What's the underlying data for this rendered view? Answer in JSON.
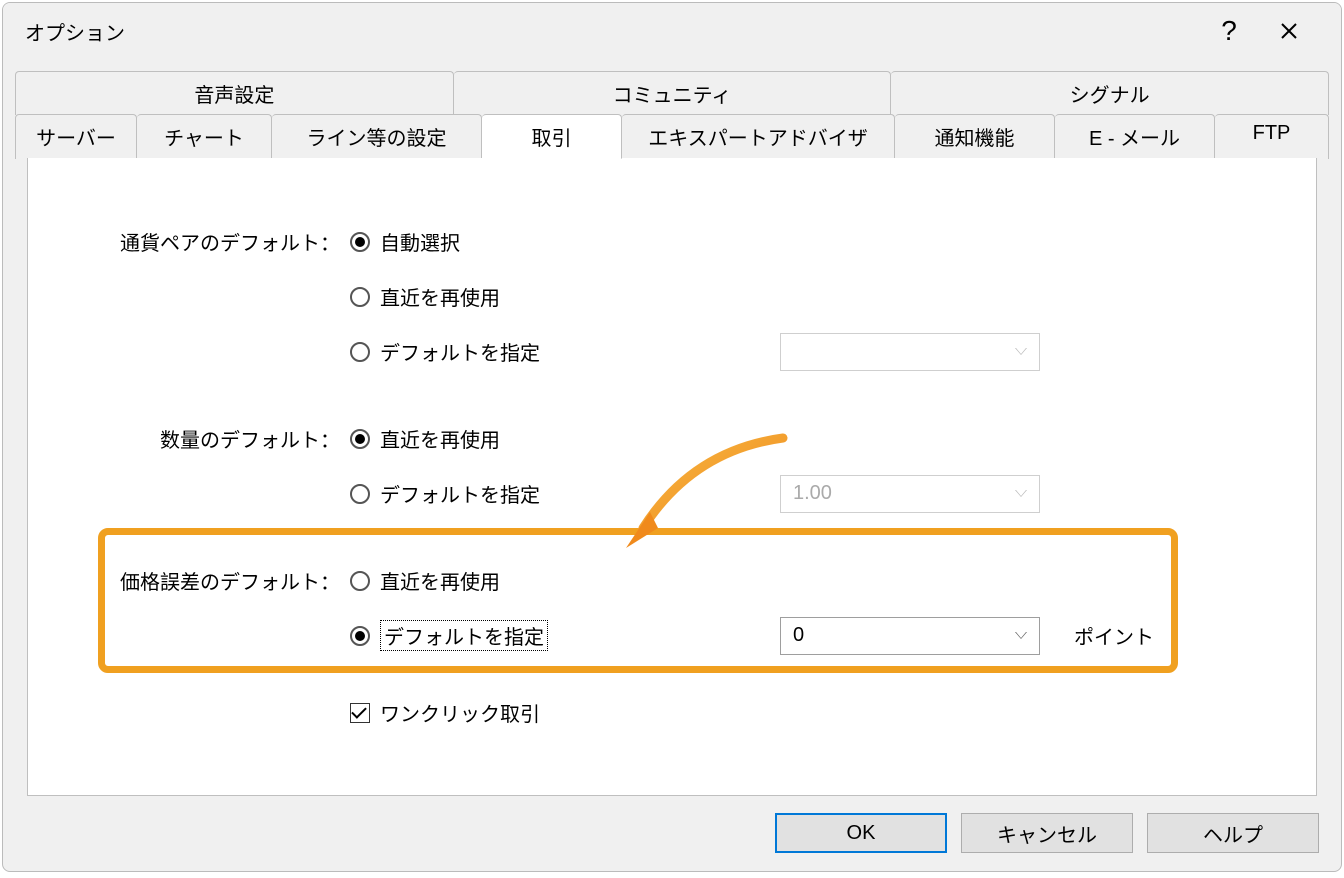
{
  "window_title": "オプション",
  "tabs_top": [
    {
      "label": "音声設定"
    },
    {
      "label": "コミュニティ"
    },
    {
      "label": "シグナル"
    }
  ],
  "tabs_bottom": [
    {
      "label": "サーバー"
    },
    {
      "label": "チャート"
    },
    {
      "label": "ライン等の設定"
    },
    {
      "label": "取引",
      "active": true
    },
    {
      "label": "エキスパートアドバイザ"
    },
    {
      "label": "通知機能"
    },
    {
      "label": "E - メール"
    },
    {
      "label": "FTP"
    }
  ],
  "form": {
    "symbol": {
      "label": "通貨ペアのデフォルト：",
      "options": {
        "auto": "自動選択",
        "last": "直近を再使用",
        "default": "デフォルトを指定"
      },
      "selected": "auto",
      "default_value": ""
    },
    "volume": {
      "label": "数量のデフォルト：",
      "options": {
        "last": "直近を再使用",
        "default": "デフォルトを指定"
      },
      "selected": "last",
      "default_value": "1.00"
    },
    "deviation": {
      "label": "価格誤差のデフォルト：",
      "options": {
        "last": "直近を再使用",
        "default": "デフォルトを指定"
      },
      "selected": "default",
      "default_value": "0",
      "unit": "ポイント"
    },
    "one_click": {
      "label": "ワンクリック取引",
      "checked": true
    }
  },
  "buttons": {
    "ok": "OK",
    "cancel": "キャンセル",
    "help": "ヘルプ"
  }
}
